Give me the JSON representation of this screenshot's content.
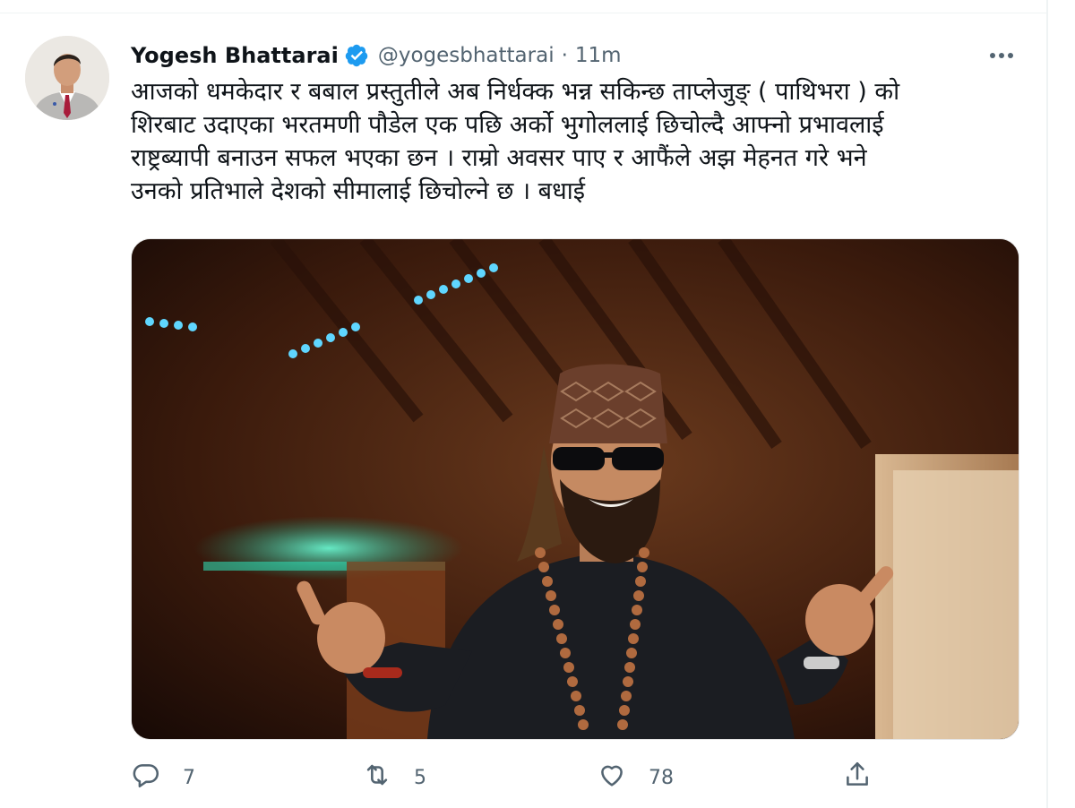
{
  "tweet": {
    "author_name": "Yogesh Bhattarai",
    "handle": "@yogesbhattarai",
    "separator": "·",
    "time": "11m",
    "text_lines": [
      "आजको धमकेदार र बबाल प्रस्तुतीले अब निर्धक्क भन्न सकिन्छ ताप्लेजुङ् ( पाथिभरा ) को",
      "शिरबाट उदाएका भरतमणी पौडेल  एक पछि अर्को भुगोललाई छिचोल्दै आफ्नो प्रभावलाई",
      "राष्ट्रब्यापी बनाउन सफल भएका छन । राम्रो अवसर पाए र आफैंले अझ मेहनत गरे भने",
      "उनको प्रतिभाले देशको सीमालाई छिचोल्ने छ । बधाई"
    ]
  },
  "actions": {
    "reply_count": "7",
    "retweet_count": "5",
    "like_count": "78"
  },
  "icons": {
    "verified": "verified-badge-icon",
    "more": "more-icon",
    "reply": "reply-icon",
    "retweet": "retweet-icon",
    "like": "heart-icon",
    "share": "share-icon"
  },
  "colors": {
    "verified_blue": "#1d9bf0",
    "secondary_text": "#536471",
    "primary_text": "#0f1419"
  }
}
